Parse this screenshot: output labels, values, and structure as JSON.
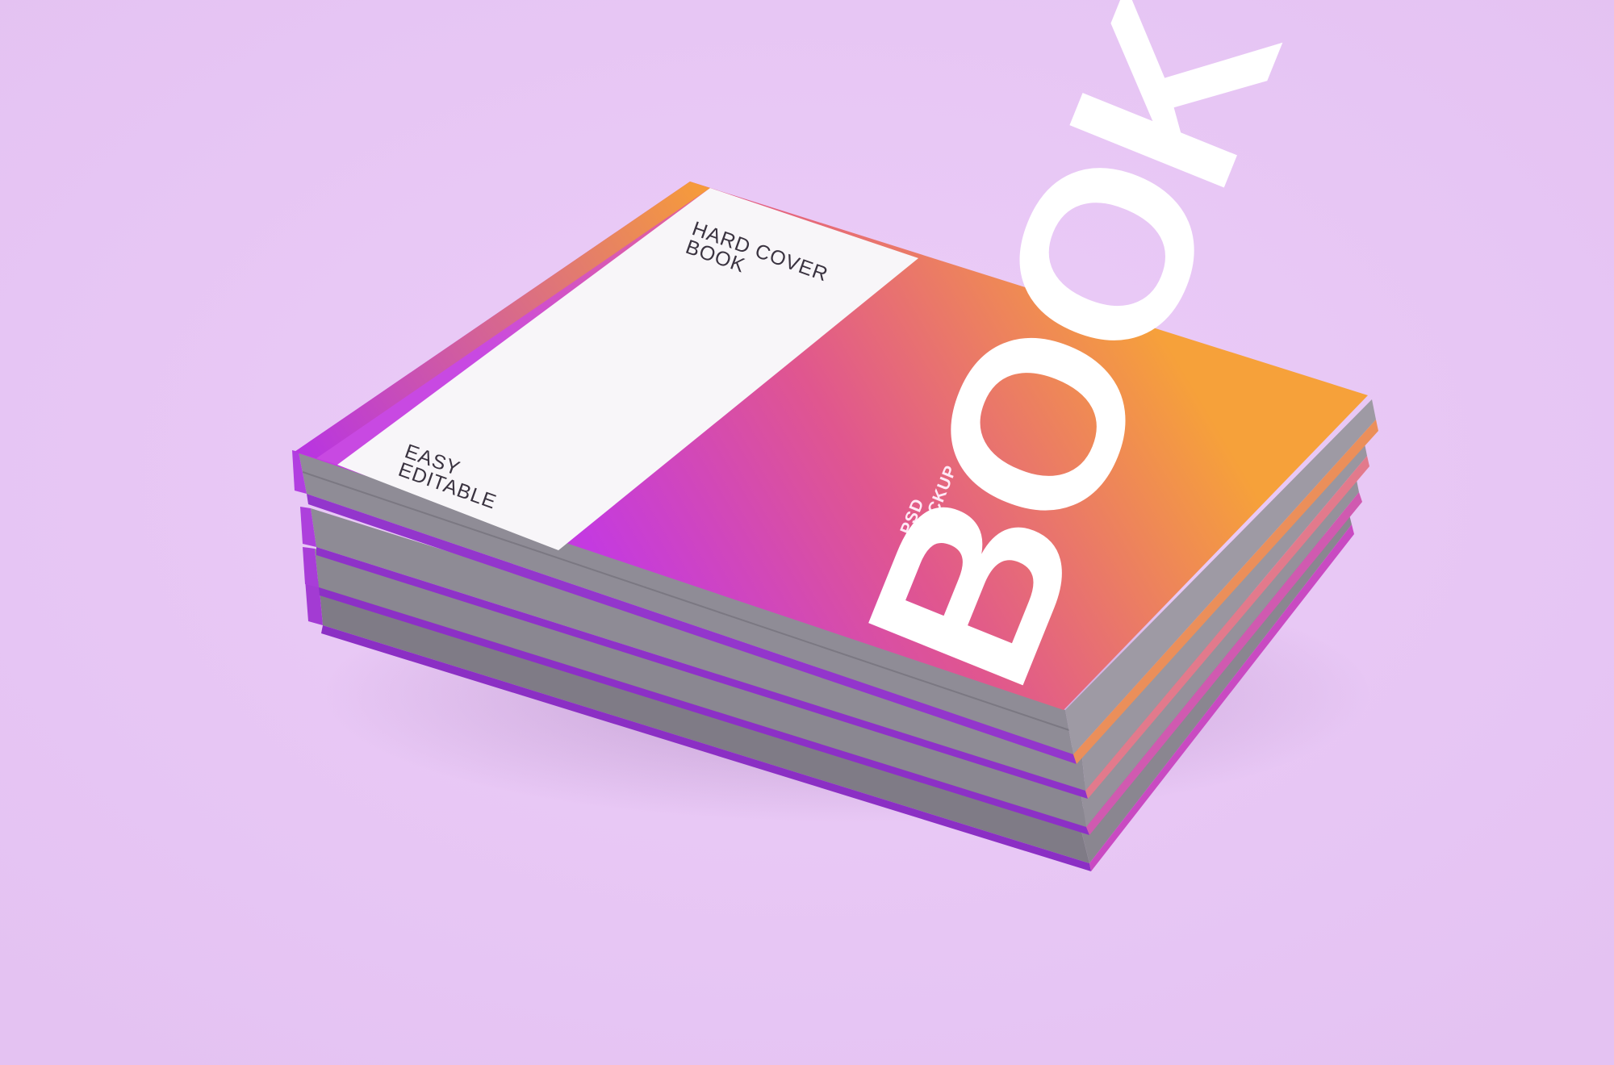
{
  "scene": {
    "subject": "book-stack-mockup",
    "book_count": 4,
    "colors": {
      "background": "#e9c9f6",
      "cover_orange": "#f6a13a",
      "cover_magenta": "#c43ae0",
      "page_edges": "#8e8b95",
      "white_panel": "#f4f2f6"
    }
  },
  "cover": {
    "panel_title": "HARD COVER\nBOOK",
    "panel_subtitle": "EASY\nEDITABLE",
    "big_title": "BOOK",
    "small_tag": "PSD\nMOCKUP"
  }
}
